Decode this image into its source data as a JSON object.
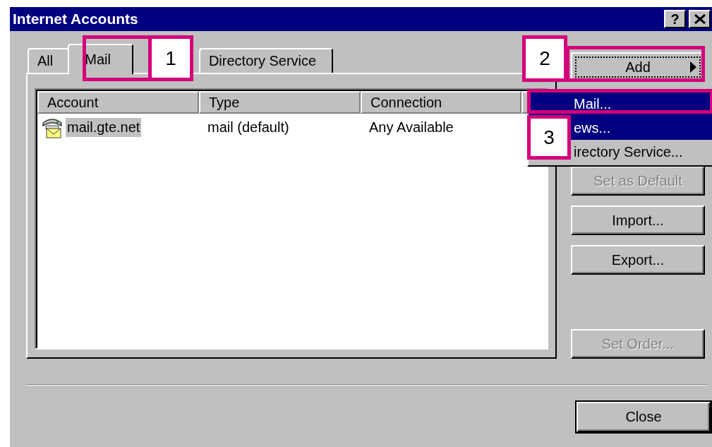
{
  "window": {
    "title": "Internet Accounts",
    "help_button": "?"
  },
  "tabs": [
    {
      "label": "All",
      "selected": false
    },
    {
      "label": "Mail",
      "selected": true
    },
    {
      "label": "Directory Service",
      "selected": false
    }
  ],
  "accounts": {
    "columns": [
      "Account",
      "Type",
      "Connection",
      ""
    ],
    "rows": [
      {
        "account": "mail.gte.net",
        "type": "mail (default)",
        "connection": "Any Available",
        "selected": true
      }
    ]
  },
  "buttons": [
    {
      "label": "Add",
      "kind": "menu",
      "focused": true,
      "disabled": false
    },
    {
      "label": "Set as Default",
      "kind": "push",
      "focused": false,
      "disabled": true
    },
    {
      "label": "Import...",
      "kind": "push",
      "focused": false,
      "disabled": false
    },
    {
      "label": "Export...",
      "kind": "push",
      "focused": false,
      "disabled": false
    },
    {
      "label": "Set Order...",
      "kind": "push",
      "focused": false,
      "disabled": true
    }
  ],
  "add_menu": [
    {
      "label": "Mail...",
      "selected": true
    },
    {
      "label": "ews...",
      "selected": true
    },
    {
      "label": "irectory Service...",
      "selected": false
    }
  ],
  "close_button": "Close",
  "callouts": [
    "1",
    "2",
    "3"
  ]
}
